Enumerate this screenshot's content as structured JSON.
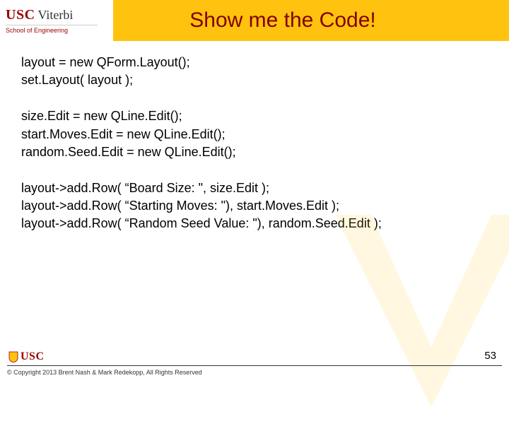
{
  "header": {
    "logo_usc": "USC",
    "logo_viterbi": "Viterbi",
    "logo_sub": "School of Engineering",
    "title": "Show me the Code!"
  },
  "code": {
    "block1": [
      "layout = new QForm.Layout();",
      "set.Layout( layout );"
    ],
    "block2": [
      "size.Edit = new QLine.Edit();",
      "start.Moves.Edit = new QLine.Edit();",
      "random.Seed.Edit = new QLine.Edit();"
    ],
    "block3": [
      "layout->add.Row( “Board Size: \", size.Edit );",
      "layout->add.Row( “Starting Moves: \"), start.Moves.Edit );",
      "layout->add.Row( “Random Seed Value: \"), random.Seed.Edit );"
    ]
  },
  "footer": {
    "usc": "USC",
    "copyright": "© Copyright 2013 Brent Nash & Mark Redekopp, All Rights Reserved",
    "page": "53"
  }
}
